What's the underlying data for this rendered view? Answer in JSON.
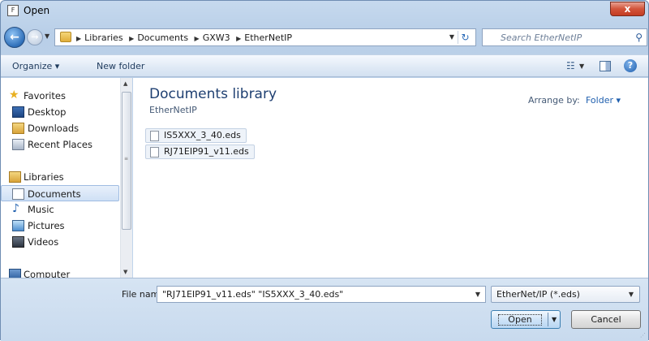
{
  "window": {
    "title": "Open",
    "app_icon": "document-icon",
    "close_label": "x"
  },
  "address": {
    "crumbs": [
      "Libraries",
      "Documents",
      "GXW3",
      "EtherNetIP"
    ],
    "back_glyph": "←",
    "forward_glyph": "→",
    "refresh_glyph": "↻"
  },
  "search": {
    "placeholder": "Search EtherNetIP"
  },
  "toolbar": {
    "organize_label": "Organize ▾",
    "new_folder_label": "New folder",
    "help_label": "?"
  },
  "sidebar": {
    "items": [
      {
        "label": "Favorites",
        "icon": "star-icon"
      },
      {
        "label": "Desktop",
        "icon": "desktop-icon"
      },
      {
        "label": "Downloads",
        "icon": "downloads-icon"
      },
      {
        "label": "Recent Places",
        "icon": "recent-places-icon"
      },
      {
        "label": "Libraries",
        "icon": "libraries-icon"
      },
      {
        "label": "Documents",
        "icon": "documents-icon",
        "selected": true
      },
      {
        "label": "Music",
        "icon": "music-icon"
      },
      {
        "label": "Pictures",
        "icon": "pictures-icon"
      },
      {
        "label": "Videos",
        "icon": "videos-icon"
      },
      {
        "label": "Computer",
        "icon": "computer-icon"
      }
    ]
  },
  "main": {
    "library_title": "Documents library",
    "library_subtitle": "EtherNetIP",
    "arrange_label": "Arrange by:",
    "arrange_value": "Folder ▾",
    "files": [
      "IS5XXX_3_40.eds",
      "RJ71EIP91_v11.eds"
    ]
  },
  "footer": {
    "file_name_label": "File name:",
    "file_name_value": "\"RJ71EIP91_v11.eds\" \"IS5XXX_3_40.eds\"",
    "file_type_value": "EtherNet/IP (*.eds)",
    "open_label": "Open",
    "cancel_label": "Cancel"
  },
  "colors": {
    "title_accent": "#1e3f71",
    "link_blue": "#1f5fae",
    "close_red": "#c43c23"
  }
}
